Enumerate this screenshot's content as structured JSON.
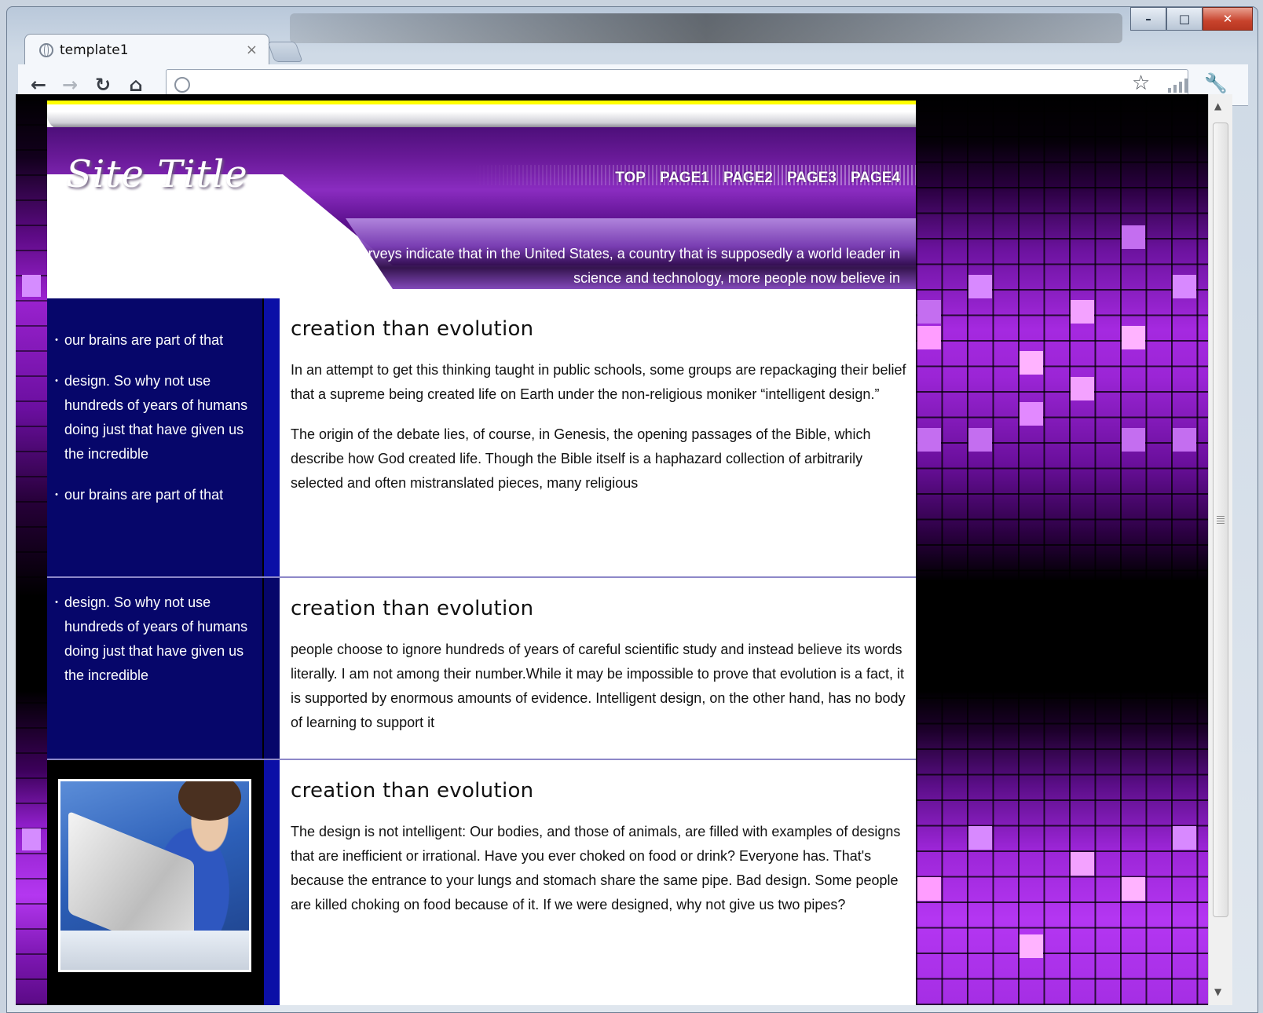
{
  "browser": {
    "tab_title": "template1",
    "tab_close": "×",
    "window_controls": {
      "minimize": "–",
      "maximize": "□",
      "close": "✕"
    },
    "nav_icons": [
      "back-icon",
      "forward-icon",
      "reload-icon",
      "home-icon"
    ],
    "address_value": ""
  },
  "site": {
    "title": "Site Title",
    "nav": [
      "TOP",
      "PAGE1",
      "PAGE2",
      "PAGE3",
      "PAGE4"
    ],
    "description": "Surveys indicate that in the United States, a country that is supposedly a world leader in science and technology, more people now believe in"
  },
  "sections": [
    {
      "sidebar": [
        "our brains are part of that",
        "design. So why not use hundreds of years of humans doing just that have given us the incredible",
        "our brains are part of that"
      ],
      "heading": "creation than evolution",
      "paragraphs": [
        "In an attempt to get this thinking taught in public schools, some groups are repackaging their belief that a supreme being created life on Earth under the non-religious moniker “intelligent design.”",
        "The origin of the debate lies, of course, in Genesis, the opening passages of the Bible, which describe how God created life. Though the Bible itself is a haphazard collection of arbitrarily selected and often mistranslated pieces, many religious"
      ]
    },
    {
      "sidebar": [
        "design. So why not use hundreds of years of humans doing just that have given us the incredible"
      ],
      "heading": "creation than evolution",
      "paragraphs": [
        "people choose to ignore hundreds of years of careful scientific study and instead believe its words literally. I am not among their number.While it may be impossible to prove that evolution is a fact, it is supported by enormous amounts of evidence. Intelligent design, on the other hand, has no body of learning to support it"
      ]
    },
    {
      "sidebar": [],
      "heading": "creation than evolution",
      "paragraphs": [
        "The design is not intelligent: Our bodies, and those of animals, are filled with examples of designs that are inefficient or irrational. Have you ever choked on food or drink? Everyone has. That's because the entrance to your lungs and stomach share the same pipe. Bad design. Some people are killed choking on food because of it. If we were designed, why not give us two pipes?"
      ]
    }
  ],
  "colors": {
    "sidebar": "#06066a",
    "accent_bar": "#0b0fa6",
    "header_purple": "#6a1a99",
    "top_line": "#ffff00",
    "separator": "#8d88c8"
  }
}
